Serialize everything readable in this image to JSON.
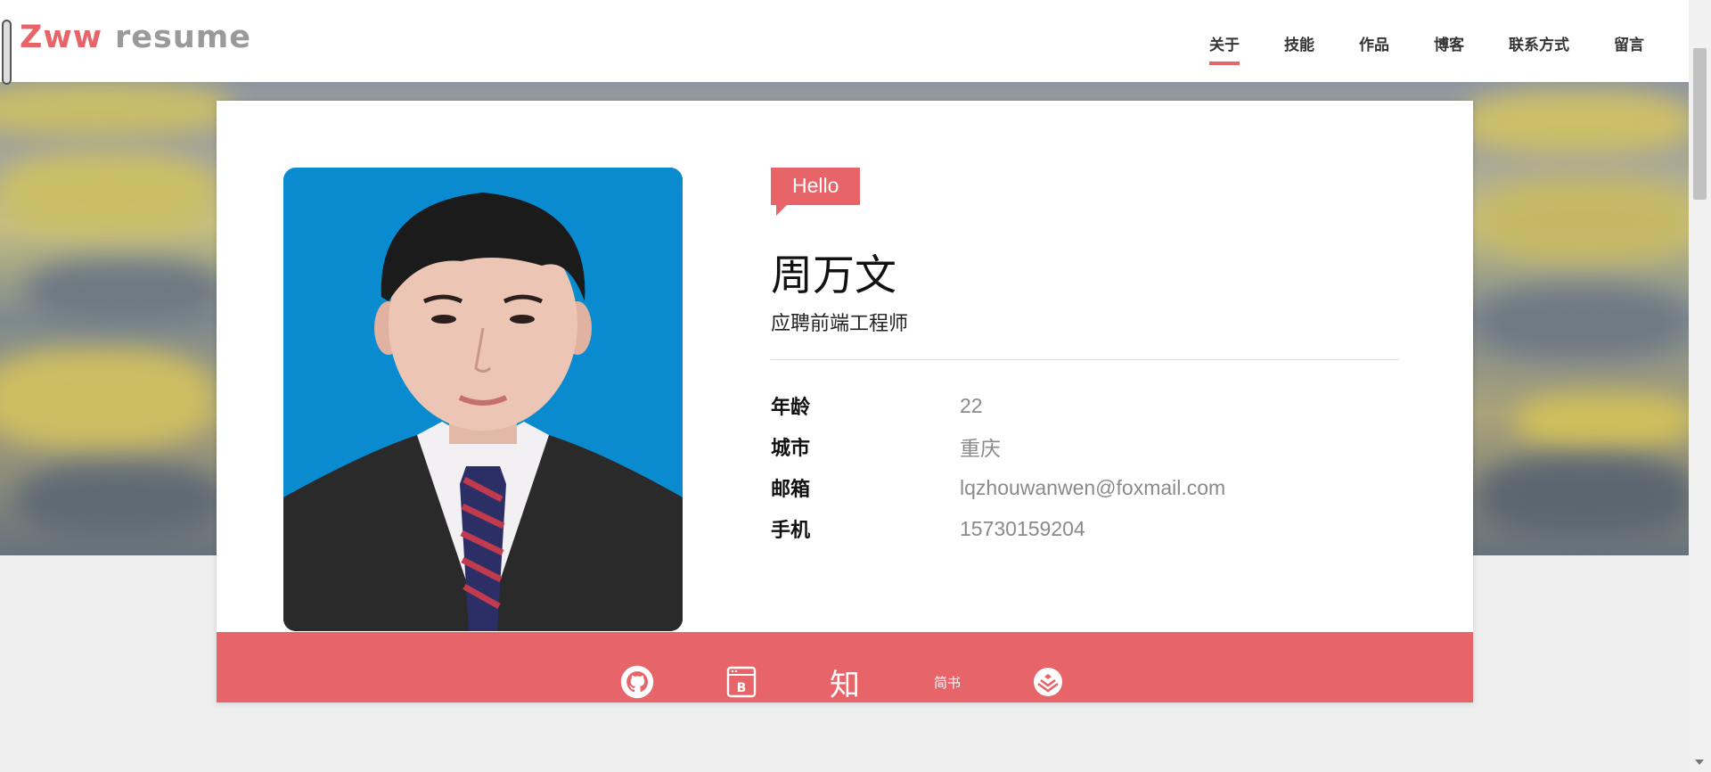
{
  "header": {
    "logo_brand": "Zww",
    "logo_rest": "resume",
    "nav": [
      {
        "label": "关于",
        "active": true
      },
      {
        "label": "技能",
        "active": false
      },
      {
        "label": "作品",
        "active": false
      },
      {
        "label": "博客",
        "active": false
      },
      {
        "label": "联系方式",
        "active": false
      },
      {
        "label": "留言",
        "active": false
      }
    ]
  },
  "profile": {
    "greeting": "Hello",
    "name": "周万文",
    "role": "应聘前端工程师",
    "fields": [
      {
        "label": "年龄",
        "value": "22"
      },
      {
        "label": "城市",
        "value": "重庆"
      },
      {
        "label": "邮箱",
        "value": "lqzhouwanwen@foxmail.com"
      },
      {
        "label": "手机",
        "value": "15730159204"
      }
    ]
  },
  "social": [
    {
      "icon": "github-icon"
    },
    {
      "icon": "blog-icon",
      "text": "B"
    },
    {
      "icon": "zhihu-icon",
      "text": "知"
    },
    {
      "icon": "jianshu-icon",
      "text": "简书"
    },
    {
      "icon": "juejin-icon"
    }
  ],
  "colors": {
    "accent": "#e76569",
    "muted_text": "#8a8a8a"
  }
}
